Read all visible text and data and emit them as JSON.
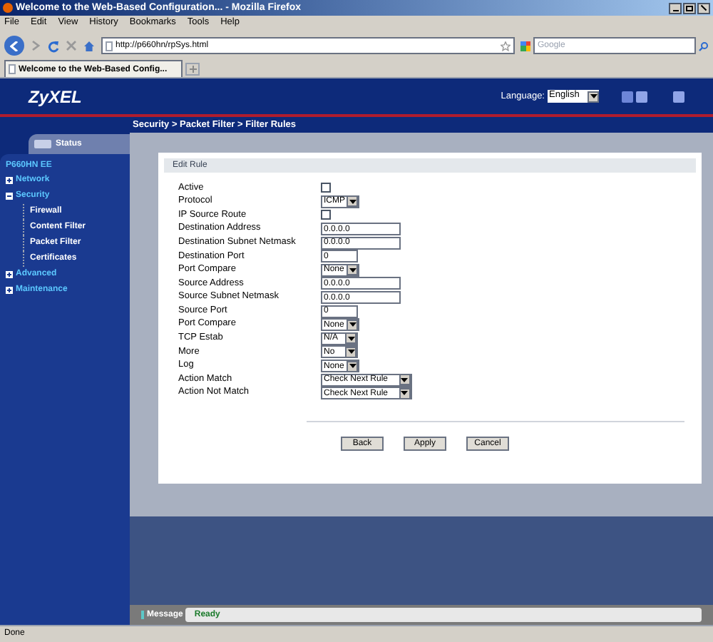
{
  "window": {
    "title": "Welcome to the Web-Based Configuration... - Mozilla Firefox"
  },
  "menu": [
    "File",
    "Edit",
    "View",
    "History",
    "Bookmarks",
    "Tools",
    "Help"
  ],
  "address": {
    "value": "http://p660hn/rpSys.html"
  },
  "search": {
    "placeholder": "Google"
  },
  "tabs": [
    {
      "label": "Welcome to the Web-Based Config...",
      "selected": true
    }
  ],
  "header": {
    "logo": "ZyXEL",
    "language_label": "Language:",
    "language": "English"
  },
  "breadcrumb": "Security > Packet Filter > Filter Rules",
  "sidebar": {
    "status": "Status",
    "device": "P660HN EE",
    "items": [
      {
        "label": "Network",
        "expanded": false
      },
      {
        "label": "Security",
        "expanded": true,
        "children": [
          {
            "label": "Firewall"
          },
          {
            "label": "Content Filter"
          },
          {
            "label": "Packet Filter"
          },
          {
            "label": "Certificates"
          }
        ]
      },
      {
        "label": "Advanced",
        "expanded": false
      },
      {
        "label": "Maintenance",
        "expanded": false
      }
    ]
  },
  "form": {
    "title": "Edit Rule",
    "rows": [
      {
        "label": "Active",
        "kind": "checkbox",
        "checked": false
      },
      {
        "label": "Protocol",
        "kind": "select",
        "value": "ICMP"
      },
      {
        "label": "IP Source Route",
        "kind": "checkbox",
        "checked": false
      },
      {
        "label": "Destination Address",
        "kind": "text",
        "value": "0.0.0.0"
      },
      {
        "label": "Destination Subnet Netmask",
        "kind": "text",
        "value": "0.0.0.0"
      },
      {
        "label": "Destination Port",
        "kind": "text",
        "value": "0"
      },
      {
        "label": "Port Compare",
        "kind": "select",
        "value": "None"
      },
      {
        "label": "Source Address",
        "kind": "text",
        "value": "0.0.0.0"
      },
      {
        "label": "Source Subnet Netmask",
        "kind": "text",
        "value": "0.0.0.0"
      },
      {
        "label": "Source Port",
        "kind": "text",
        "value": "0"
      },
      {
        "label": "Port Compare",
        "kind": "select",
        "value": "None"
      },
      {
        "label": "TCP Estab",
        "kind": "select",
        "value": "N/A"
      },
      {
        "label": "More",
        "kind": "select",
        "value": "No"
      },
      {
        "label": "Log",
        "kind": "select",
        "value": "None"
      },
      {
        "label": "Action Match",
        "kind": "select",
        "value": "Check Next Rule"
      },
      {
        "label": "Action Not Match",
        "kind": "select",
        "value": "Check Next Rule"
      }
    ],
    "buttons": [
      "Back",
      "Apply",
      "Cancel"
    ]
  },
  "message": {
    "label": "Message",
    "text": "Ready"
  },
  "status_bar": "Done"
}
